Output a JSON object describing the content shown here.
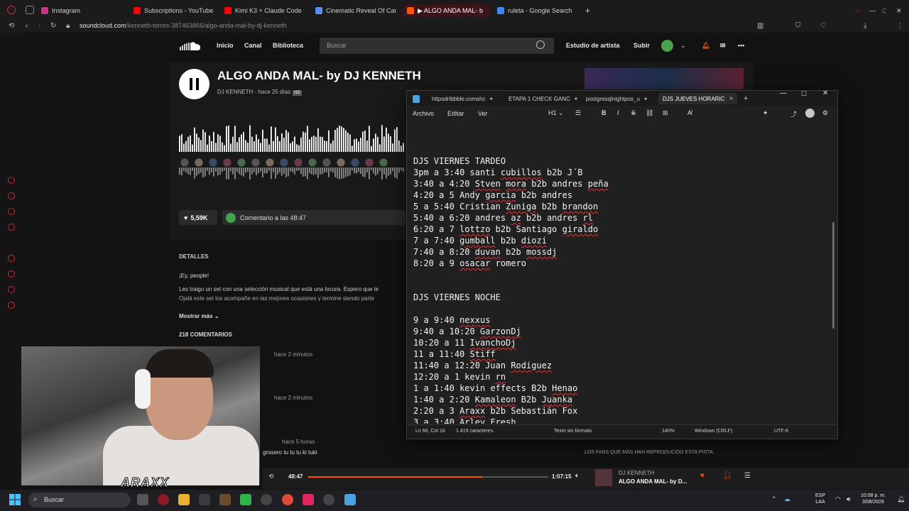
{
  "browser": {
    "tabs": [
      {
        "label": "Instagram",
        "color": "#c13584"
      },
      {
        "label": "Subscriptions - YouTube",
        "color": "#ff0000"
      },
      {
        "label": "Kimi K3 + Claude Code = I",
        "color": "#ff0000"
      },
      {
        "label": "Cinematic Reveal Of Carto",
        "color": "#5b8def"
      },
      {
        "label": "▶ ALGO ANDA MAL- b",
        "color": "#ff5500"
      },
      {
        "label": "ruleta - Google Search",
        "color": "#4285f4"
      }
    ],
    "url_domain": "soundcloud.com",
    "url_path": "/kenneth-torres-387463866/algo-anda-mal-by-dj-kenneth"
  },
  "soundcloud": {
    "nav": [
      "Inicio",
      "Canal",
      "Biblioteca"
    ],
    "search_placeholder": "Buscar",
    "right_nav": [
      "Estudio de artista",
      "Subir"
    ],
    "track_title": "ALGO ANDA MAL- by DJ KENNETH",
    "artist": "DJ KENNETH",
    "posted": "hace 25 días",
    "hd_badge": "HD",
    "likes": "5,59K",
    "comment_placeholder": "Comentario a las 48:47",
    "details_heading": "DETALLES",
    "desc_line1": "¡Ey, people!",
    "desc_line2": "Les traigo un set con una selección musical que está una locura. Espero que le",
    "desc_line3": "Ojalá este set los acompañe en las mejores ocasiones y termine siendo parte",
    "show_more": "Mostrar más",
    "comments_count": "218 COMENTARIOS",
    "comment_times": [
      "hace 2 minutos",
      "hace 2 minutos",
      "hace 5 horas"
    ],
    "comment_text": "grosero tu tu tu ki tuki",
    "fans_label": "LOS FANS QUE MÁS HAN REPRODUCIDO ESTA PISTA:"
  },
  "player": {
    "elapsed": "48:47",
    "total": "1:07:15",
    "progress": 0.725,
    "artist": "DJ KENNETH",
    "title": "ALGO ANDA MAL- by D..."
  },
  "webcam": {
    "logo": "ARAXX"
  },
  "notepad": {
    "tabs": [
      "httpsdribbble.comshc",
      "ETAPA 1 CHECK GANC",
      "postgresqlnightpos_u",
      "DJS JUEVES HORARIC"
    ],
    "menu": [
      "Archivo",
      "Editar",
      "Ver"
    ],
    "heading_tool": "H1",
    "lines": [
      "DJS VIERNES TARDEO",
      "3pm a 3:40 santi cubillos b2b J´B",
      "3:40 a 4:20 Stven mora b2b andres peña",
      "4:20 a 5 Andy garcia b2b andres",
      "5 a 5:40 Cristian Zuniga b2b brandon",
      "5:40 a 6:20 andres az b2b andres rl",
      "6:20 a 7 lottzo b2b Santiago giraldo",
      "7 a 7:40 gumball b2b diozi",
      "7:40 a 8:20 duvan b2b mossdj",
      "8:20 a 9 osacar romero",
      "",
      "",
      "DJS VIERNES NOCHE",
      "",
      "9 a 9:40 nexxus",
      "9:40 a 10:20 GarzonDj",
      "10:20 a 11 IvanchoDj",
      "11 a 11:40 Stiff",
      "11:40 a 12:20 Juan Rodiguez",
      "12:20 a 1 kevin rn",
      "1 a 1:40 kevin effects B2b Henao",
      "1:40 a 2:20 Kamaleon B2b Juanka",
      "2:20 a 3 Araxx b2b Sebastián Fox",
      "3 a 3:40 Arley Fresh"
    ],
    "status": {
      "position": "Ln 66, Col 16",
      "chars": "1.419 caracteres.",
      "format": "Texto sin formato",
      "zoom": "140%",
      "eol": "Windows (CRLF)",
      "encoding": "UTF-8"
    }
  },
  "taskbar": {
    "search": "Buscar",
    "lang": "ESP",
    "region": "LAA",
    "time": "10:08 p. m.",
    "date": "3/08/2026"
  }
}
